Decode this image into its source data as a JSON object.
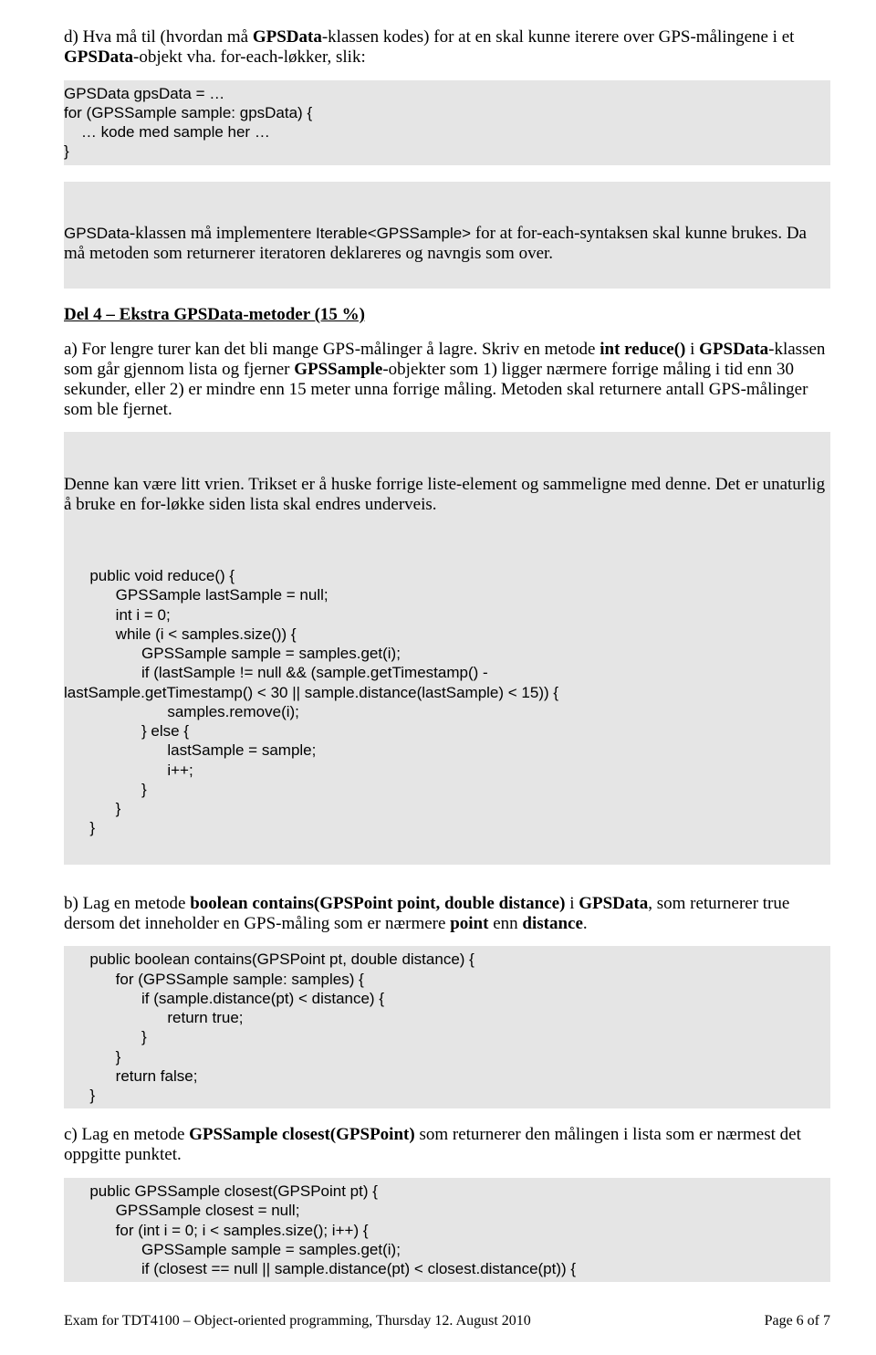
{
  "intro_d": {
    "pre1": "d) Hva må til (hvordan må ",
    "b1": "GPSData",
    "mid1": "-klassen kodes) for at en skal kunne iterere over GPS-målingene i et ",
    "b2": "GPSData",
    "post1": "-objekt vha. for-each-løkker, slik:"
  },
  "code1": "GPSData gpsData = …\nfor (GPSSample sample: gpsData) {\n    … kode med sample her …\n}",
  "answer_d": {
    "pre": "",
    "c1": "GPSData",
    "mid1": "-klassen må implementere ",
    "c2": "Iterable<GPSSample>",
    "mid2": " for at for-each-syntaksen skal kunne brukes. Da må metoden som returnerer iteratoren deklareres og navngis som over."
  },
  "heading4": "Del 4 – Ekstra GPSData-metoder (15 %)",
  "intro_a": {
    "pre": "a) For lengre turer kan det bli mange GPS-målinger å lagre. Skriv en metode ",
    "b1": "int reduce()",
    "mid1": " i ",
    "b2": "GPSData",
    "mid2": "-klassen som går gjennom lista og fjerner ",
    "b3": "GPSSample",
    "post": "-objekter som 1) ligger nærmere forrige måling i tid enn 30 sekunder, eller 2) er mindre enn 15 meter unna forrige måling. Metoden skal returnere antall GPS-målinger som ble fjernet."
  },
  "answer_a_prose": "Denne kan være litt vrien. Trikset er å huske forrige liste-element og sammeligne med denne. Det er unaturlig å bruke en for-løkke siden lista skal endres underveis.",
  "code_a": "      public void reduce() {\n            GPSSample lastSample = null;\n            int i = 0;\n            while (i < samples.size()) {\n                  GPSSample sample = samples.get(i);\n                  if (lastSample != null && (sample.getTimestamp() -\nlastSample.getTimestamp() < 30 || sample.distance(lastSample) < 15)) {\n                        samples.remove(i);\n                  } else {\n                        lastSample = sample;\n                        i++;\n                  }\n            }\n      }",
  "intro_b": {
    "pre": "b) Lag en metode ",
    "b1": "boolean contains(GPSPoint point, double distance)",
    "mid1": " i ",
    "b2": "GPSData",
    "mid2": ", som returnerer true dersom det inneholder en GPS-måling som er nærmere ",
    "b3": "point",
    "mid3": " enn ",
    "b4": "distance",
    "post": "."
  },
  "code_b": "      public boolean contains(GPSPoint pt, double distance) {\n            for (GPSSample sample: samples) {\n                  if (sample.distance(pt) < distance) {\n                        return true;\n                  }\n            }\n            return false;\n      }",
  "intro_c": {
    "pre": "c) Lag en metode ",
    "b1": "GPSSample closest(GPSPoint)",
    "post": " som returnerer den målingen i lista som er nærmest det oppgitte punktet."
  },
  "code_c": "      public GPSSample closest(GPSPoint pt) {\n            GPSSample closest = null;\n            for (int i = 0; i < samples.size(); i++) {\n                  GPSSample sample = samples.get(i);\n                  if (closest == null || sample.distance(pt) < closest.distance(pt)) {",
  "footer_left": "Exam for TDT4100 – Object-oriented programming, Thursday 12. August 2010",
  "footer_right": "Page 6 of 7"
}
